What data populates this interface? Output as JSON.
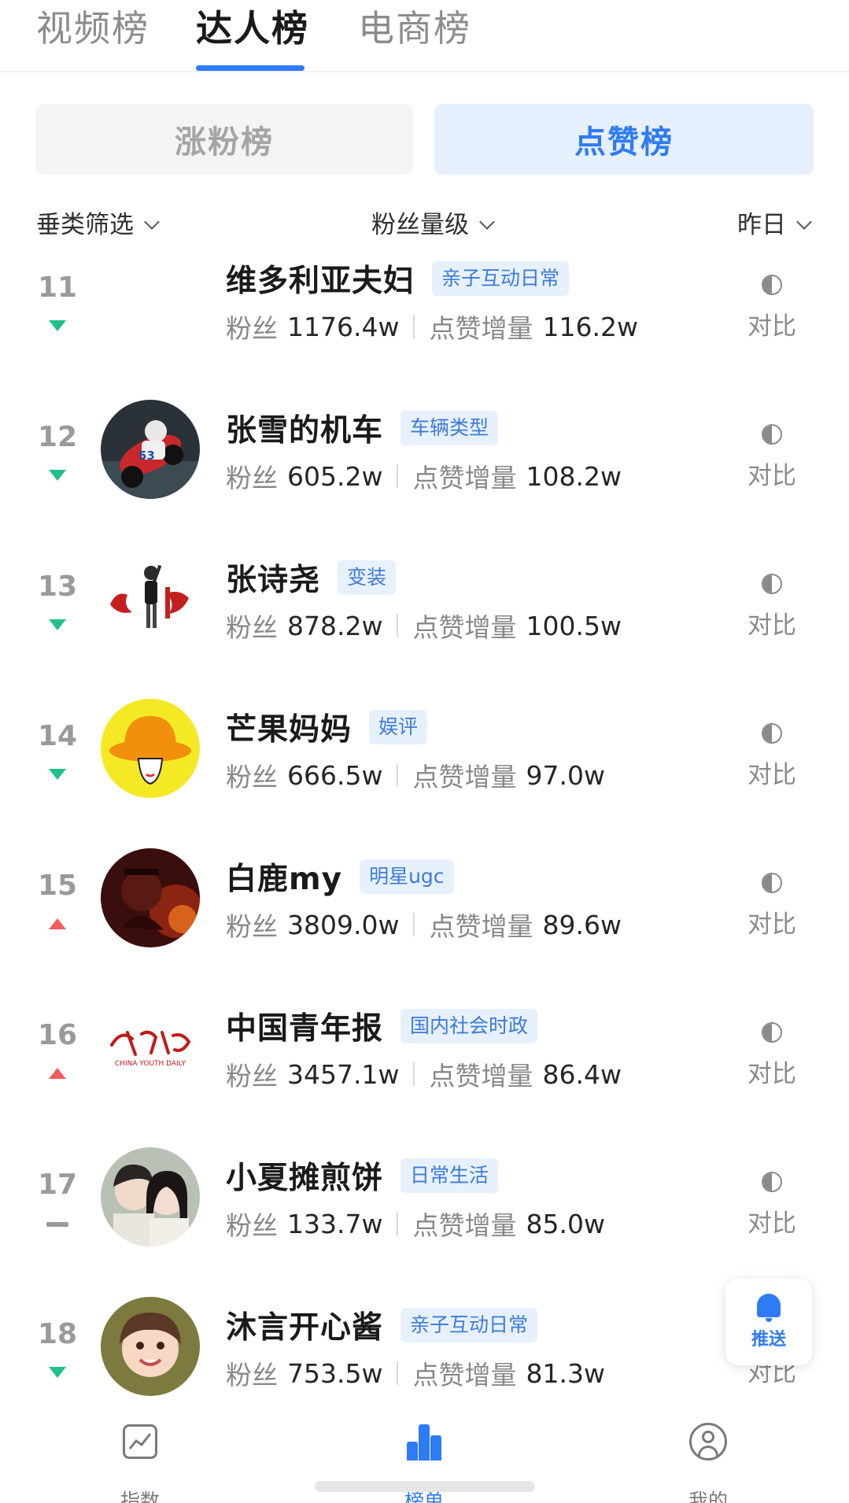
{
  "top_tabs": [
    {
      "label": "视频榜",
      "active": false
    },
    {
      "label": "达人榜",
      "active": true
    },
    {
      "label": "电商榜",
      "active": false
    }
  ],
  "segments": {
    "left": "涨粉榜",
    "right": "点赞榜",
    "selected": "点赞榜"
  },
  "filters": {
    "category": "垂类筛选",
    "fans_level": "粉丝量级",
    "date": "昨日"
  },
  "stat_labels": {
    "fans": "粉丝",
    "likes": "点赞增量",
    "compare": "对比"
  },
  "creators": [
    {
      "rank": "11",
      "trend": "down",
      "name": "维多利亚夫妇",
      "tag": "亲子互动日常",
      "fans": "1176.4w",
      "likes": "116.2w",
      "avatar": "none"
    },
    {
      "rank": "12",
      "trend": "down",
      "name": "张雪的机车",
      "tag": "车辆类型",
      "fans": "605.2w",
      "likes": "108.2w",
      "avatar": "motorbike"
    },
    {
      "rank": "13",
      "trend": "down",
      "name": "张诗尧",
      "tag": "变装",
      "fans": "878.2w",
      "likes": "100.5w",
      "avatar": "calligraphy"
    },
    {
      "rank": "14",
      "trend": "down",
      "name": "芒果妈妈",
      "tag": "娱评",
      "fans": "666.5w",
      "likes": "97.0w",
      "avatar": "hat"
    },
    {
      "rank": "15",
      "trend": "up",
      "name": "白鹿my",
      "tag": "明星ugc",
      "fans": "3809.0w",
      "likes": "89.6w",
      "avatar": "dark-red"
    },
    {
      "rank": "16",
      "trend": "up",
      "name": "中国青年报",
      "tag": "国内社会时政",
      "fans": "3457.1w",
      "likes": "86.4w",
      "avatar": "newspaper-logo",
      "logo_sub": "CHINA YOUTH DAILY"
    },
    {
      "rank": "17",
      "trend": "flat",
      "name": "小夏摊煎饼",
      "tag": "日常生活",
      "fans": "133.7w",
      "likes": "85.0w",
      "avatar": "couple"
    },
    {
      "rank": "18",
      "trend": "down",
      "name": "沐言开心酱",
      "tag": "亲子互动日常",
      "fans": "753.5w",
      "likes": "81.3w",
      "avatar": "child"
    }
  ],
  "push_button": {
    "label": "推送"
  },
  "bottom_nav": [
    {
      "label": "指数",
      "icon": "chart-icon"
    },
    {
      "label": "榜单",
      "icon": "ranking-icon"
    },
    {
      "label": "我的",
      "icon": "user-icon"
    }
  ],
  "colors": {
    "accent": "#2f7bf6",
    "down": "#20c08a",
    "up": "#f25c5c"
  }
}
